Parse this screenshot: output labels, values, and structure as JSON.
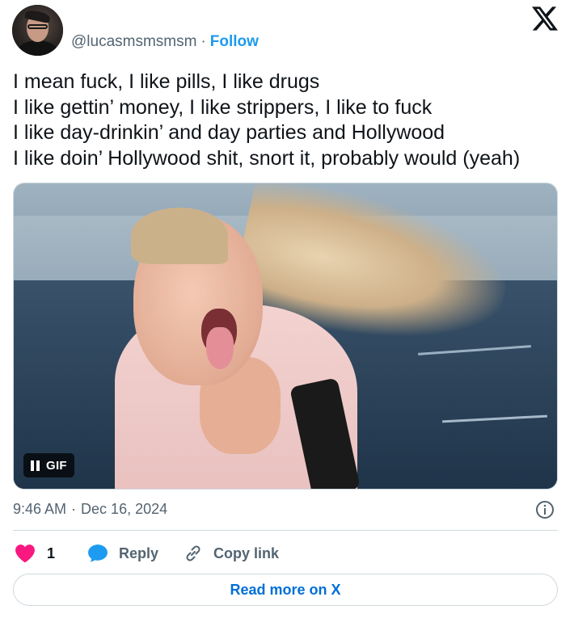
{
  "author": {
    "handle": "@lucasmsmsmsm",
    "separator": "·",
    "follow_label": "Follow"
  },
  "tweet": {
    "lines": [
      "I mean fuck, I like pills, I like drugs",
      "I like gettin’ money, I like strippers, I like to fuck",
      "I like day-drinkin’ and day parties and Hollywood",
      "I like doin’ Hollywood shit, snort it, probably would (yeah)"
    ]
  },
  "media": {
    "badge_label": "GIF",
    "pause_icon": "pause-icon"
  },
  "meta": {
    "time": "9:46 AM",
    "separator": "·",
    "date": "Dec 16, 2024"
  },
  "actions": {
    "like_count": "1",
    "reply_label": "Reply",
    "copy_label": "Copy link"
  },
  "read_more_label": "Read more on X",
  "colors": {
    "accent": "#1d9bf0",
    "heart": "#f91880",
    "link": "#006fd6",
    "muted": "#536471",
    "border": "#cfd9de"
  }
}
